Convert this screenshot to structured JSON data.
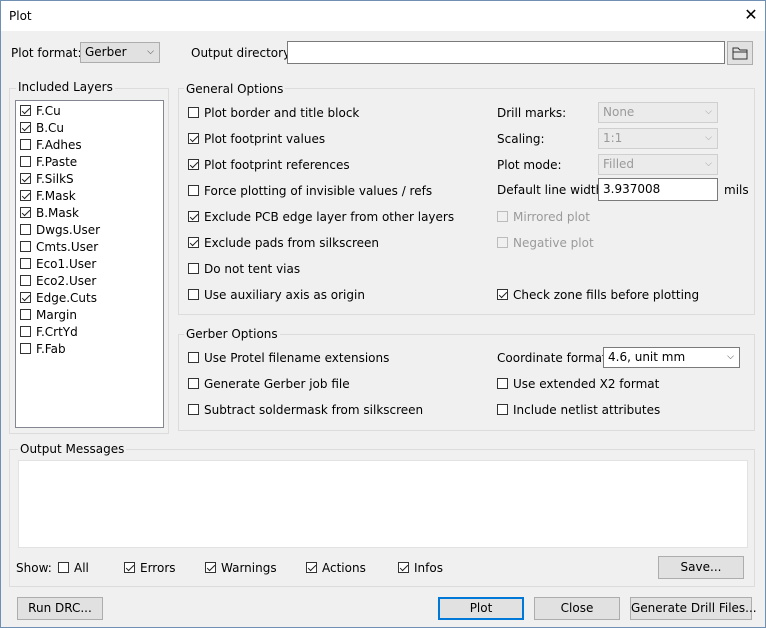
{
  "window": {
    "title": "Plot",
    "close_glyph": "✕"
  },
  "top": {
    "plot_format_label": "Plot format:",
    "plot_format_value": "Gerber",
    "output_dir_label": "Output directory:",
    "output_dir_value": ""
  },
  "layers": {
    "title": "Included Layers",
    "items": [
      {
        "label": "F.Cu",
        "checked": true
      },
      {
        "label": "B.Cu",
        "checked": true
      },
      {
        "label": "F.Adhes",
        "checked": false
      },
      {
        "label": "F.Paste",
        "checked": false
      },
      {
        "label": "F.SilkS",
        "checked": true
      },
      {
        "label": "F.Mask",
        "checked": true
      },
      {
        "label": "B.Mask",
        "checked": true
      },
      {
        "label": "Dwgs.User",
        "checked": false
      },
      {
        "label": "Cmts.User",
        "checked": false
      },
      {
        "label": "Eco1.User",
        "checked": false
      },
      {
        "label": "Eco2.User",
        "checked": false
      },
      {
        "label": "Edge.Cuts",
        "checked": true
      },
      {
        "label": "Margin",
        "checked": false
      },
      {
        "label": "F.CrtYd",
        "checked": false
      },
      {
        "label": "F.Fab",
        "checked": false
      }
    ]
  },
  "general": {
    "title": "General Options",
    "left": [
      {
        "label": "Plot border and title block",
        "checked": false
      },
      {
        "label": "Plot footprint values",
        "checked": true
      },
      {
        "label": "Plot footprint references",
        "checked": true
      },
      {
        "label": "Force plotting of invisible values / refs",
        "checked": false
      },
      {
        "label": "Exclude PCB edge layer from other layers",
        "checked": true
      },
      {
        "label": "Exclude pads from silkscreen",
        "checked": true
      },
      {
        "label": "Do not tent vias",
        "checked": false
      },
      {
        "label": "Use auxiliary axis as origin",
        "checked": false
      }
    ],
    "drill_marks_label": "Drill marks:",
    "drill_marks_value": "None",
    "scaling_label": "Scaling:",
    "scaling_value": "1:1",
    "plot_mode_label": "Plot mode:",
    "plot_mode_value": "Filled",
    "line_width_label": "Default line width:",
    "line_width_value": "3.937008",
    "line_width_unit": "mils",
    "mirrored_label": "Mirrored plot",
    "negative_label": "Negative plot",
    "check_zone_label": "Check zone fills before plotting"
  },
  "gerber": {
    "title": "Gerber Options",
    "protel_label": "Use Protel filename extensions",
    "job_file_label": "Generate Gerber job file",
    "subtract_label": "Subtract soldermask from silkscreen",
    "coord_label": "Coordinate format:",
    "coord_value": "4.6, unit mm",
    "x2_label": "Use extended X2 format",
    "netlist_label": "Include netlist attributes"
  },
  "messages": {
    "title": "Output Messages",
    "show_label": "Show:",
    "all_label": "All",
    "errors_label": "Errors",
    "warnings_label": "Warnings",
    "actions_label": "Actions",
    "infos_label": "Infos",
    "save_label": "Save..."
  },
  "bottom": {
    "run_drc_label": "Run DRC...",
    "plot_label": "Plot",
    "close_label": "Close",
    "drill_label": "Generate Drill Files..."
  }
}
